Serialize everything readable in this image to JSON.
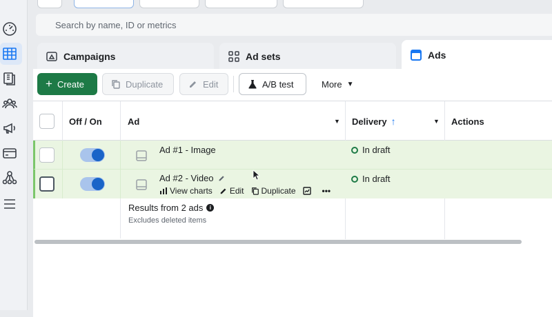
{
  "search": {
    "placeholder": "Search by name, ID or metrics"
  },
  "tabs": [
    {
      "label": "Campaigns",
      "icon": "campaign-folder-icon"
    },
    {
      "label": "Ad sets",
      "icon": "ad-sets-grid-icon"
    },
    {
      "label": "Ads",
      "icon": "ads-window-icon"
    }
  ],
  "toolbar": {
    "create_label": "Create",
    "duplicate_label": "Duplicate",
    "edit_label": "Edit",
    "ab_test_label": "A/B test",
    "more_label": "More"
  },
  "table": {
    "columns": {
      "off_on": "Off / On",
      "ad": "Ad",
      "delivery": "Delivery",
      "actions": "Actions"
    },
    "rows": [
      {
        "name": "Ad #1 - Image",
        "status": "In draft",
        "toggle_on": true
      },
      {
        "name": "Ad #2 - Video",
        "status": "In draft",
        "toggle_on": true
      }
    ],
    "row_actions": {
      "view_charts": "View charts",
      "edit": "Edit",
      "duplicate": "Duplicate",
      "more": "•••"
    },
    "summary": {
      "title": "Results from 2 ads",
      "subtitle": "Excludes deleted items"
    }
  },
  "colors": {
    "accent": "#1877f2",
    "create_button": "#1d7a46",
    "row_highlight": "#eaf5e2",
    "toggle_knob": "#1a64c8"
  }
}
